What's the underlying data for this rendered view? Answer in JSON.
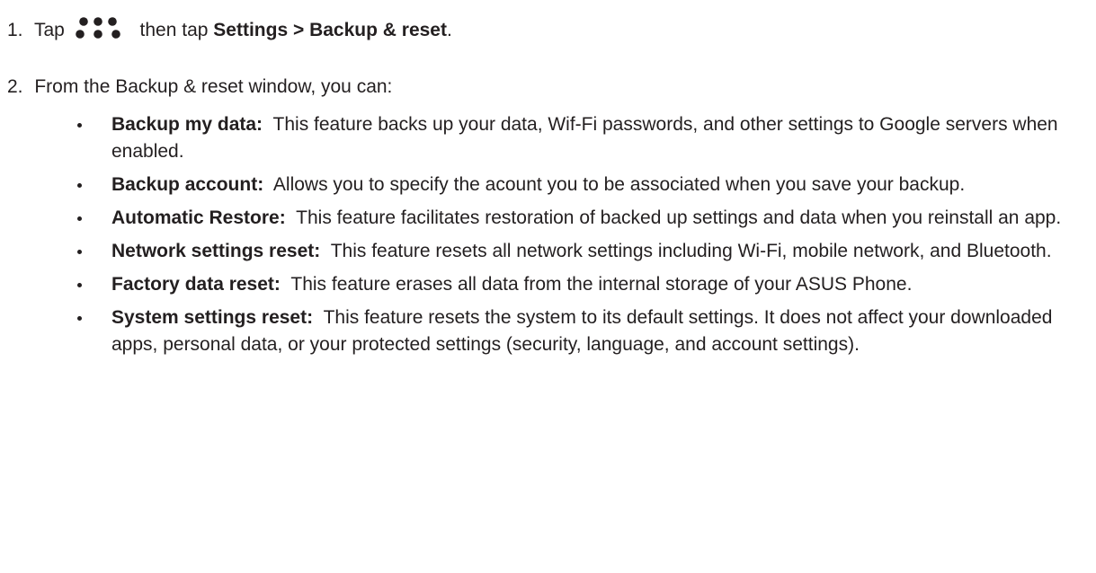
{
  "step1": {
    "number": "1.",
    "tap": "Tap",
    "icon": "more-options-dots-icon",
    "then_tap": "then tap",
    "path_settings": "Settings",
    "path_separator": ">",
    "path_target": "Backup & reset",
    "period": "."
  },
  "step2": {
    "number": "2.",
    "text": "From the Backup & reset window, you can:"
  },
  "bullets": [
    {
      "term": "Backup my data:",
      "description": "This feature backs up your data, Wif-Fi passwords, and other settings to Google servers when enabled."
    },
    {
      "term": "Backup account:",
      "description": "Allows you to specify the acount you to be associated when you save your backup."
    },
    {
      "term": "Automatic Restore:",
      "description": "This feature facilitates restoration of backed up settings and data when you reinstall an app."
    },
    {
      "term": "Network settings reset:",
      "description": "This feature resets all network settings including Wi-Fi, mobile network, and Bluetooth."
    },
    {
      "term": "Factory data reset:",
      "description": "This feature erases all data from the internal storage of your ASUS Phone."
    },
    {
      "term": "System settings reset:",
      "description": "This feature resets the system to its default settings. It does not affect your downloaded apps, personal data, or your protected settings (security, language, and account settings)."
    }
  ]
}
